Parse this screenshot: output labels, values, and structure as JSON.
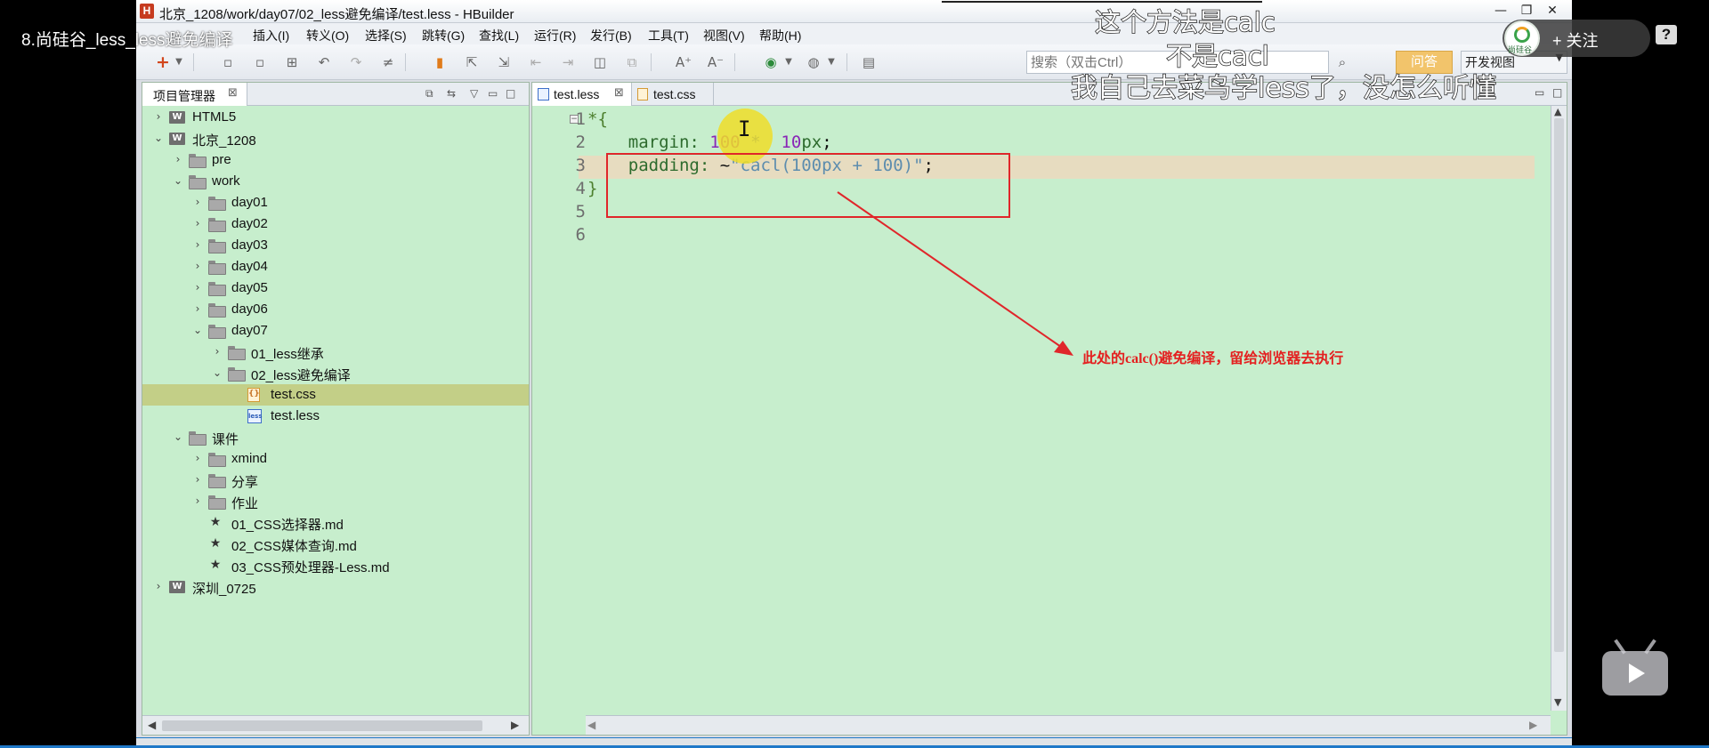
{
  "video": {
    "title": "8.尚硅谷_less_less避免编译",
    "subtitles": [
      "这个方法是calc",
      "不是cacl",
      "我自己去菜鸟学less了，没怎么听懂"
    ],
    "follow_label": "关注",
    "follow_plus": "+",
    "avatar_text": "尚硅谷",
    "help_label": "?"
  },
  "window": {
    "app_icon": "H",
    "title": "北京_1208/work/day07/02_less避免编译/test.less - HBuilder",
    "controls": {
      "minimize": "—",
      "restore": "❐",
      "close": "✕"
    }
  },
  "menubar": [
    "插入(I)",
    "转义(O)",
    "选择(S)",
    "跳转(G)",
    "查找(L)",
    "运行(R)",
    "发行(B)",
    "工具(T)",
    "视图(V)",
    "帮助(H)"
  ],
  "toolbar": {
    "search_placeholder": "搜索（双击Ctrl）",
    "ask_label": "问答",
    "view_select_value": "开发视图"
  },
  "project_manager": {
    "tab_label": "项目管理器",
    "tree": [
      {
        "label": "HTML5",
        "type": "project",
        "depth": 0,
        "expanded": false
      },
      {
        "label": "北京_1208",
        "type": "project",
        "depth": 0,
        "expanded": true
      },
      {
        "label": "pre",
        "type": "folder",
        "depth": 1,
        "expanded": false
      },
      {
        "label": "work",
        "type": "folder",
        "depth": 1,
        "expanded": true
      },
      {
        "label": "day01",
        "type": "folder",
        "depth": 2,
        "expanded": false
      },
      {
        "label": "day02",
        "type": "folder",
        "depth": 2,
        "expanded": false
      },
      {
        "label": "day03",
        "type": "folder",
        "depth": 2,
        "expanded": false
      },
      {
        "label": "day04",
        "type": "folder",
        "depth": 2,
        "expanded": false
      },
      {
        "label": "day05",
        "type": "folder",
        "depth": 2,
        "expanded": false
      },
      {
        "label": "day06",
        "type": "folder",
        "depth": 2,
        "expanded": false
      },
      {
        "label": "day07",
        "type": "folder",
        "depth": 2,
        "expanded": true
      },
      {
        "label": "01_less继承",
        "type": "folder",
        "depth": 3,
        "expanded": false
      },
      {
        "label": "02_less避免编译",
        "type": "folder",
        "depth": 3,
        "expanded": true
      },
      {
        "label": "test.css",
        "type": "css",
        "depth": 4,
        "selected": true
      },
      {
        "label": "test.less",
        "type": "less",
        "depth": 4
      },
      {
        "label": "课件",
        "type": "folder",
        "depth": 1,
        "expanded": true
      },
      {
        "label": "xmind",
        "type": "folder",
        "depth": 2,
        "expanded": false
      },
      {
        "label": "分享",
        "type": "folder",
        "depth": 2,
        "expanded": false
      },
      {
        "label": "作业",
        "type": "folder",
        "depth": 2,
        "expanded": false
      },
      {
        "label": "01_CSS选择器.md",
        "type": "md",
        "depth": 2
      },
      {
        "label": "02_CSS媒体查询.md",
        "type": "md",
        "depth": 2
      },
      {
        "label": "03_CSS预处理器-Less.md",
        "type": "md",
        "depth": 2
      },
      {
        "label": "深圳_0725",
        "type": "project",
        "depth": 0,
        "expanded": false
      }
    ]
  },
  "editor": {
    "tabs": [
      {
        "label": "test.less",
        "active": true
      },
      {
        "label": "test.css",
        "active": false
      }
    ],
    "line_numbers": [
      "1",
      "2",
      "3",
      "4",
      "5",
      "6"
    ],
    "current_line": 3,
    "annotation": "此处的calc()避免编译，留给浏览器去执行"
  }
}
